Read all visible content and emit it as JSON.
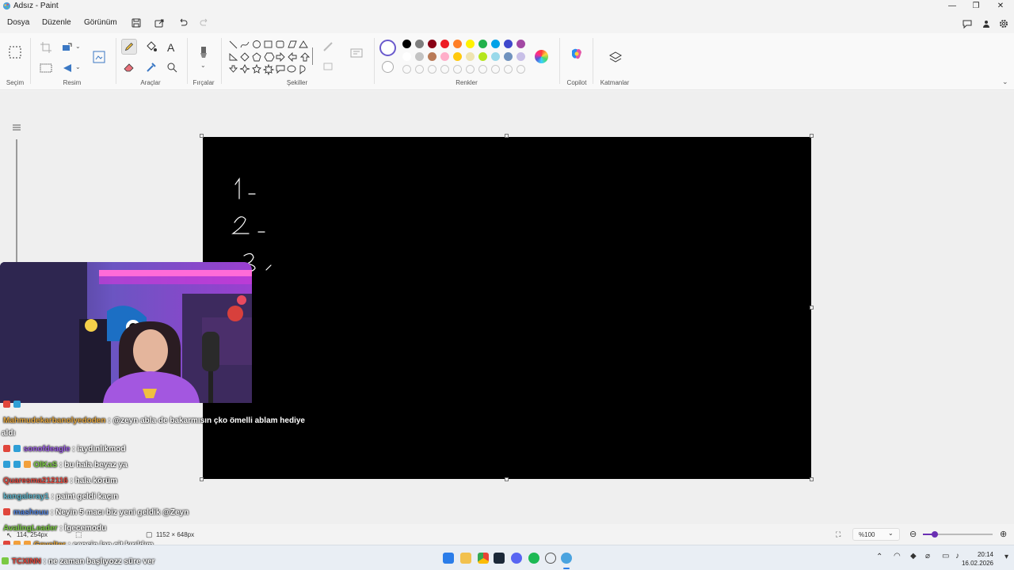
{
  "window": {
    "title": "Adsız - Paint"
  },
  "menu": {
    "file": "Dosya",
    "edit": "Düzenle",
    "view": "Görünüm"
  },
  "ribbon": {
    "groups": {
      "selection": "Seçim",
      "image": "Resim",
      "tools": "Araçlar",
      "brushes": "Fırçalar",
      "shapes": "Şekiller",
      "colors": "Renkler",
      "copilot": "Copilot",
      "layers": "Katmanlar"
    },
    "palette_row1": [
      "#000000",
      "#7f7f7f",
      "#880015",
      "#ed1c24",
      "#ff7f27",
      "#fff200",
      "#22b14c",
      "#00a2e8",
      "#3f48cc",
      "#a349a4"
    ],
    "palette_row2": [
      "#ffffff",
      "#c3c3c3",
      "#b97a57",
      "#ffaec9",
      "#ffc90e",
      "#efe4b0",
      "#b5e61d",
      "#99d9ea",
      "#7092be",
      "#c8bfe7"
    ]
  },
  "status": {
    "cursor_pos": "114, 254px",
    "canvas_size": "1152 × 648px",
    "zoom": "%100"
  },
  "chat": [
    {
      "user": "",
      "msg": "",
      "user_color": "#ffffff"
    },
    {
      "user": "Mahmudekarbanolyedoden",
      "msg": ": @zeyn abla de bakarmısın çko ömelli ablam hediye",
      "user_color": "#e0a33c"
    },
    {
      "user": "",
      "msg": "aldı",
      "user_color": "#ffffff"
    },
    {
      "user": "sonofdeagle",
      "msg": ": iaydınlıkmod",
      "user_color": "#9b5de5"
    },
    {
      "user": "OlKaS",
      "msg": ": bu hala beyaz ya",
      "user_color": "#7ac943"
    },
    {
      "user": "Quaresma212116",
      "msg": ": hala körüm",
      "user_color": "#e0463c"
    },
    {
      "user": "kangaleray1",
      "msg": ": paint geldi kaçın",
      "user_color": "#5fb4c9"
    },
    {
      "user": "mashouu",
      "msg": ": Neyin 5 macı biz yeni geldik @Zeyn",
      "user_color": "#4f7fd9"
    },
    {
      "user": "AvalingLeader",
      "msg": ": İgecemodu",
      "user_color": "#7ac943"
    },
    {
      "user": "Gevolter",
      "msg": ": sensin lan çit kırıldım",
      "user_color": "#e0a33c"
    },
    {
      "user": "TCXINN",
      "msg": ": ne zaman başlıyozz süre ver",
      "user_color": "#e0463c"
    }
  ],
  "taskbar": {
    "time": "20:14",
    "date": "16.02.2026"
  }
}
